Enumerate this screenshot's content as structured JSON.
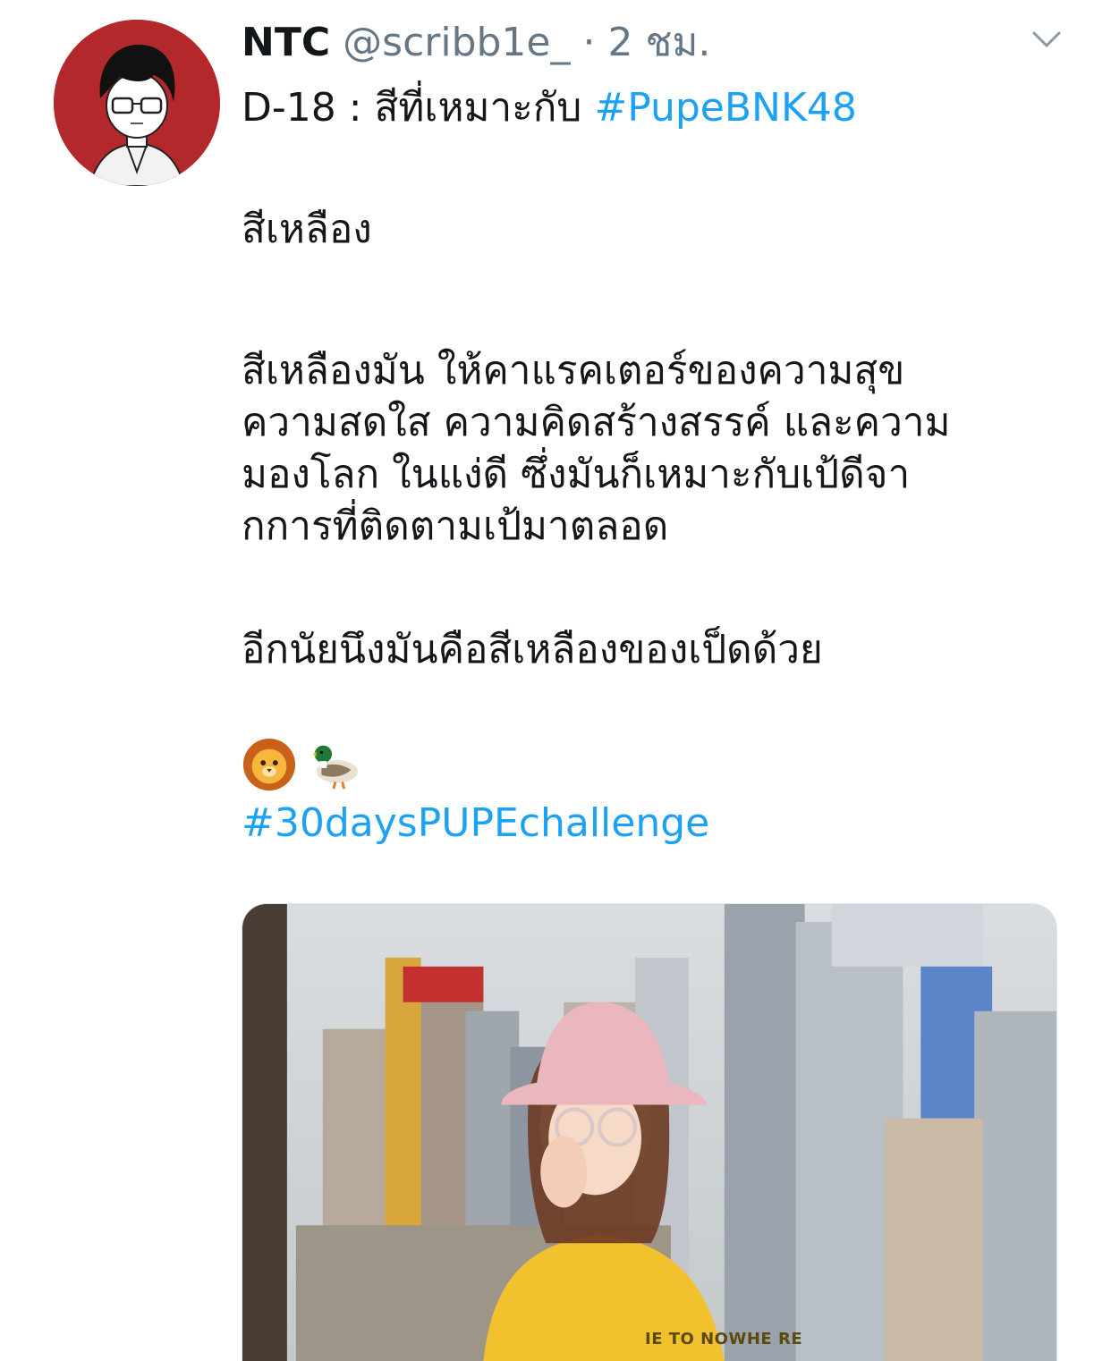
{
  "tweet": {
    "display_name": "NTC",
    "handle": "@scribb1e_",
    "separator": "·",
    "time": "2 ชม.",
    "line1_prefix": "D-18 : สีที่เหมาะกับ ",
    "line1_hashtag": "#PupeBNK48",
    "paragraph1": "สีเหลือง",
    "paragraph2_lines": [
      "สีเหลืองมัน ให้คาแรคเตอร์ของความสุข",
      "ความสดใส ความคิดสร้างสรรค์ และความ",
      "มองโลก ในแง่ดี ซึ่งมันก็เหมาะกับเป้ดีจา",
      "กการที่ติดตามเป้มาตลอด"
    ],
    "paragraph3": "อีกนัยนึงมันคือสีเหลืองของเป็ดด้วย",
    "emojis": [
      "lion-face-emoji",
      "duck-emoji"
    ],
    "hashtag2": "#30daysPUPEchallenge",
    "media_shirt_text": "IE TO NOWHE RE"
  },
  "colors": {
    "link": "#1da1f2",
    "secondary_text": "#657786",
    "avatar_bg": "#b3282a"
  }
}
